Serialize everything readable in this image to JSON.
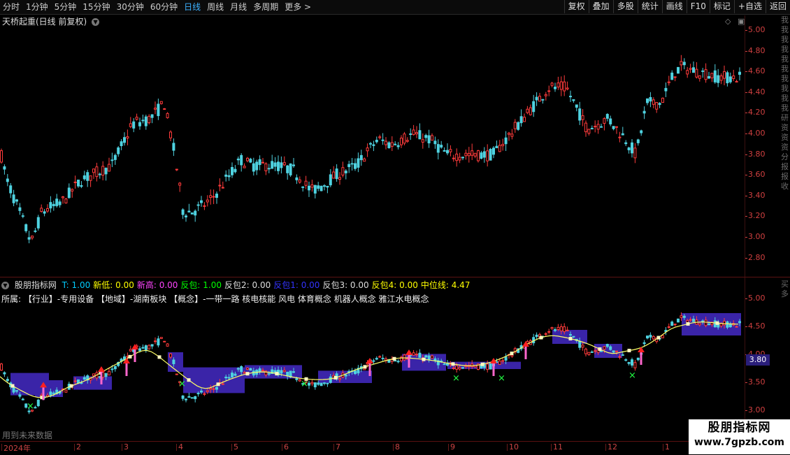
{
  "topbar": {
    "periods": [
      "分时",
      "1分钟",
      "5分钟",
      "15分钟",
      "30分钟",
      "60分钟",
      "日线",
      "周线",
      "月线",
      "多周期",
      "更多 >"
    ],
    "active_period": 6,
    "tools": [
      "复权",
      "叠加",
      "多股",
      "统计",
      "画线",
      "F10",
      "标记",
      "+自选",
      "返回"
    ]
  },
  "main_panel": {
    "title": "天桥起重(日线 前复权)",
    "price_ticks": [
      "5.00",
      "4.80",
      "4.60",
      "4.40",
      "4.20",
      "4.00",
      "3.80",
      "3.60",
      "3.40",
      "3.20",
      "3.00",
      "2.80"
    ],
    "right_vertical_text": "我我我我我我我我我我研资资资分报报收",
    "candles": {
      "up_color": "#ff3b3b",
      "down_color": "#4fd2e0"
    }
  },
  "indicator_panel": {
    "name": "股朋指标网",
    "values": [
      {
        "label": "T: 1.00",
        "color": "#00ccff"
      },
      {
        "label": "新低: 0.00",
        "color": "#ffff00"
      },
      {
        "label": "新高: 0.00",
        "color": "#ff44ff"
      },
      {
        "label": "反包: 1.00",
        "color": "#00ff00"
      },
      {
        "label": "反包2: 0.00",
        "color": "#dddddd"
      },
      {
        "label": "反包1: 0.00",
        "color": "#3333ff"
      },
      {
        "label": "反包3: 0.00",
        "color": "#dddddd"
      },
      {
        "label": "反包4: 0.00",
        "color": "#ffff00"
      },
      {
        "label": "中位线: 4.47",
        "color": "#ffff00"
      }
    ],
    "concepts": "所属:   【行业】-专用设备 【地域】-湖南板块    【概念】-一带一路 核电核能 风电 体育概念 机器人概念 雅江水电概念",
    "price_ticks": [
      "5.00",
      "4.50",
      "4.00",
      "3.50",
      "3.00"
    ],
    "current_price": "3.80",
    "right_vertical_text": "买多",
    "note": "用到未来数据",
    "box_color": "#3a24a8",
    "midline_color": "#ffff66"
  },
  "time_axis": {
    "labels": [
      "2024年",
      "2",
      "3",
      "4",
      "5",
      "6",
      "7",
      "8",
      "9",
      "10",
      "11",
      "12",
      "1"
    ]
  },
  "watermark": {
    "line1": "股朋指标网",
    "line2": "www.7gpzb.com"
  }
}
